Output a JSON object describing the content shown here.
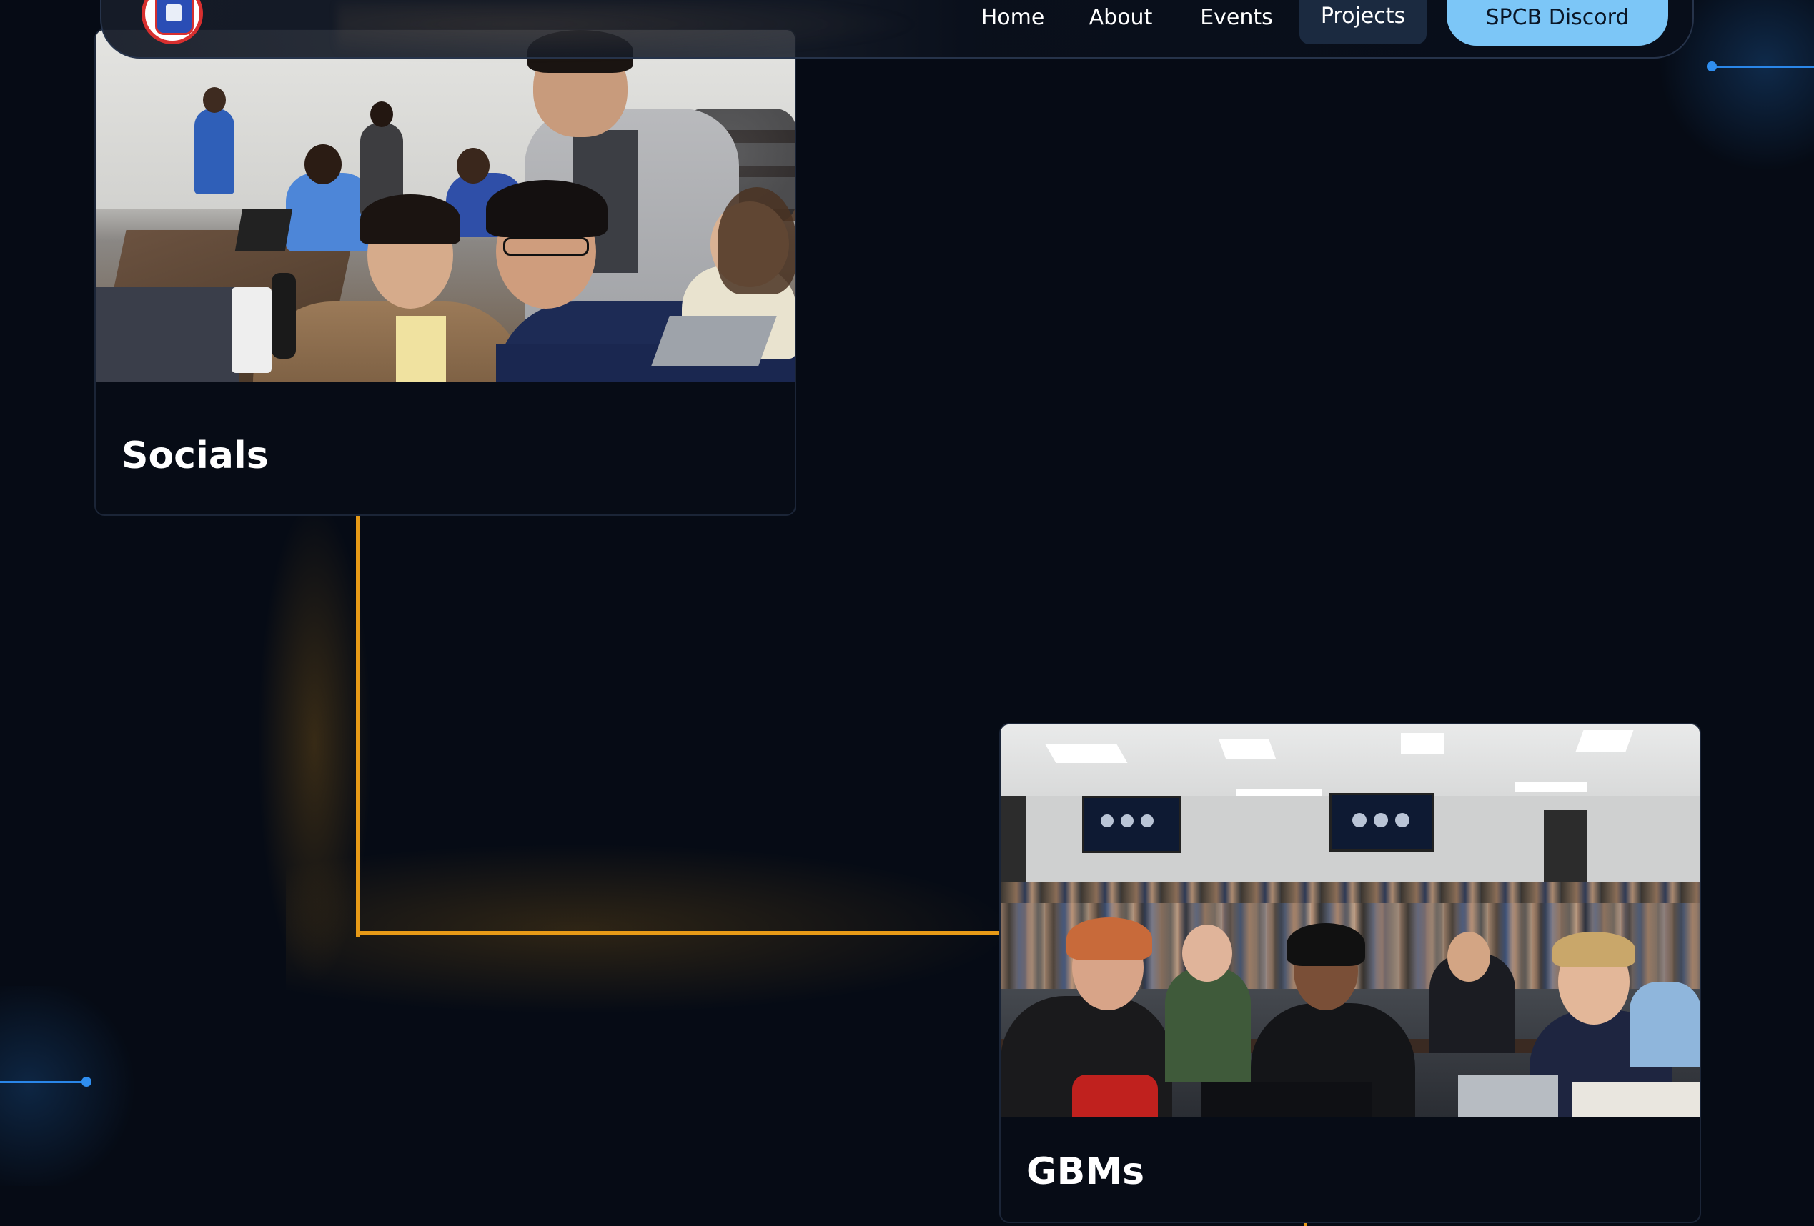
{
  "nav": {
    "links": [
      {
        "label": "Home"
      },
      {
        "label": "About"
      },
      {
        "label": "Events"
      },
      {
        "label": "Projects",
        "active": true
      }
    ],
    "discord_label": "SPCB Discord",
    "logo_icon": "spcb-seal-logo"
  },
  "cards": [
    {
      "title": "Socials",
      "image_alt": "Students smiling in a classroom at a social event"
    },
    {
      "title": "GBMs",
      "image_alt": "Large crowd of students in a lecture hall at a general body meeting"
    }
  ],
  "colors": {
    "background": "#060b15",
    "timeline_orange": "#e79a17",
    "timeline_blue": "#2a86e8",
    "discord_button": "#7cc6f7",
    "active_tab": "#1b2a40"
  }
}
